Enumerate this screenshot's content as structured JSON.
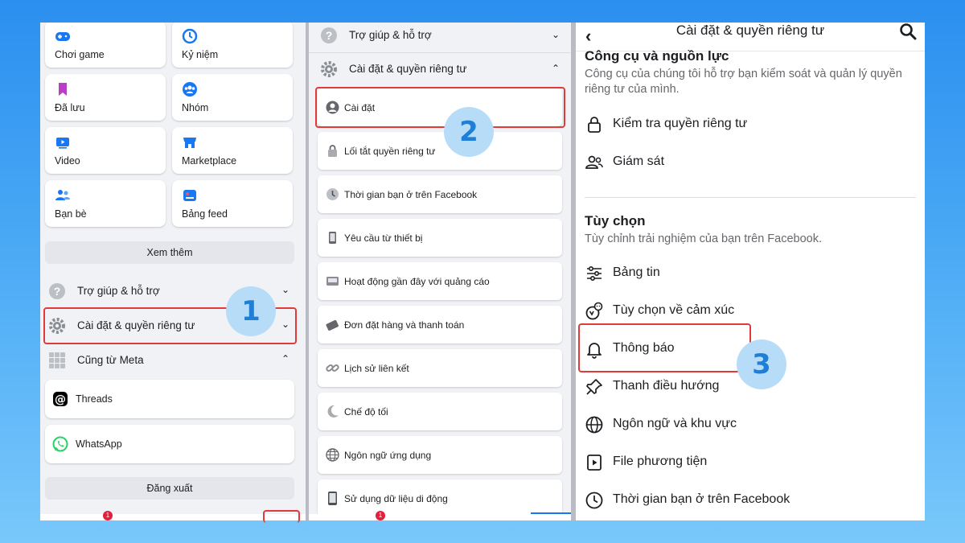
{
  "panel1": {
    "shortcuts": [
      {
        "label": "Chơi game",
        "icon": "gamepad-icon"
      },
      {
        "label": "Kỷ niệm",
        "icon": "memories-clock-icon"
      },
      {
        "label": "Đã lưu",
        "icon": "bookmark-icon"
      },
      {
        "label": "Nhóm",
        "icon": "groups-icon"
      },
      {
        "label": "Video",
        "icon": "video-icon"
      },
      {
        "label": "Marketplace",
        "icon": "marketplace-shop-icon"
      },
      {
        "label": "Bạn bè",
        "icon": "friends-icon"
      },
      {
        "label": "Bảng feed",
        "icon": "feeds-icon"
      }
    ],
    "see_more": "Xem thêm",
    "help": "Trợ giúp & hỗ trợ",
    "settings_privacy": "Cài đặt & quyền riêng tư",
    "also_from_meta": "Cũng từ Meta",
    "meta_apps": [
      {
        "label": "Threads",
        "icon": "threads-icon"
      },
      {
        "label": "WhatsApp",
        "icon": "whatsapp-icon"
      }
    ],
    "logout": "Đăng xuất",
    "notification_count": "1"
  },
  "panel2": {
    "help": "Trợ giúp & hỗ trợ",
    "settings_privacy": "Cài đặt & quyền riêng tư",
    "items": [
      {
        "label": "Cài đặt",
        "icon": "profile-circle-icon"
      },
      {
        "label": "Lối tắt quyền riêng tư",
        "icon": "privacy-lock-icon"
      },
      {
        "label": "Thời gian bạn ở trên Facebook",
        "icon": "clock-icon"
      },
      {
        "label": "Yêu cầu từ thiết bị",
        "icon": "device-icon"
      },
      {
        "label": "Hoạt động gần đây với quảng cáo",
        "icon": "ad-activity-icon"
      },
      {
        "label": "Đơn đặt hàng và thanh toán",
        "icon": "card-icon"
      },
      {
        "label": "Lịch sử liên kết",
        "icon": "link-icon"
      },
      {
        "label": "Chế độ tối",
        "icon": "moon-icon"
      },
      {
        "label": "Ngôn ngữ ứng dụng",
        "icon": "globe-icon"
      },
      {
        "label": "Sử dụng dữ liệu di động",
        "icon": "phone-data-icon"
      }
    ],
    "notification_count": "1"
  },
  "panel3": {
    "title": "Cài đặt & quyền riêng tư",
    "tools_title": "Công cụ và nguồn lực",
    "tools_desc": "Công cụ của chúng tôi hỗ trợ bạn kiểm soát và quản lý quyền riêng tư của mình.",
    "tools_items": [
      {
        "label": "Kiểm tra quyền riêng tư",
        "icon": "lock-icon"
      },
      {
        "label": "Giám sát",
        "icon": "supervision-icon"
      }
    ],
    "prefs_title": "Tùy chọn",
    "prefs_desc": "Tùy chỉnh trải nghiệm của bạn trên Facebook.",
    "prefs_items": [
      {
        "label": "Bảng tin",
        "icon": "sliders-icon"
      },
      {
        "label": "Tùy chọn về cảm xúc",
        "icon": "reactions-icon"
      },
      {
        "label": "Thông báo",
        "icon": "bell-icon"
      },
      {
        "label": "Thanh điều hướng",
        "icon": "pin-icon"
      },
      {
        "label": "Ngôn ngữ và khu vực",
        "icon": "globe-icon"
      },
      {
        "label": "File phương tiện",
        "icon": "media-file-icon"
      },
      {
        "label": "Thời gian bạn ở trên Facebook",
        "icon": "clock-icon"
      }
    ]
  },
  "steps": [
    "1",
    "2",
    "3"
  ],
  "colors": {
    "highlight": "#e03b3b",
    "step_bg": "#b7dcf8",
    "step_text": "#1f7fd6",
    "fb_blue": "#1877f2"
  }
}
